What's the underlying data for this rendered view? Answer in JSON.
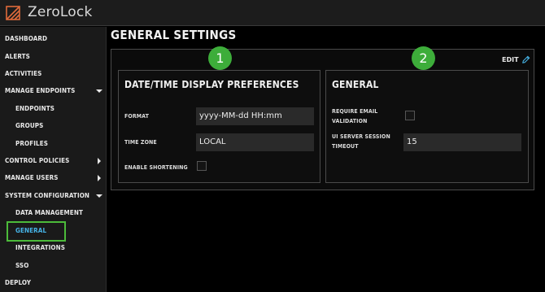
{
  "app": {
    "title": "ZeroLock",
    "logo_icon": "zerolock-logo-icon"
  },
  "colors": {
    "accent_active": "#46b3e6",
    "highlight_green": "#4cbb3a",
    "badge_green": "#3dad3a",
    "logo_orange": "#e06a3b"
  },
  "sidebar": {
    "items": [
      {
        "label": "DASHBOARD"
      },
      {
        "label": "ALERTS"
      },
      {
        "label": "ACTIVITIES"
      },
      {
        "label": "MANAGE ENDPOINTS",
        "icon": "chevron-down-icon"
      },
      {
        "label": "ENDPOINTS"
      },
      {
        "label": "GROUPS"
      },
      {
        "label": "PROFILES"
      },
      {
        "label": "CONTROL POLICIES",
        "icon": "chevron-right-icon"
      },
      {
        "label": "MANAGE USERS",
        "icon": "chevron-right-icon"
      },
      {
        "label": "SYSTEM CONFIGURATION",
        "icon": "chevron-down-icon"
      },
      {
        "label": "DATA MANAGEMENT"
      },
      {
        "label": "GENERAL",
        "active": true
      },
      {
        "label": "INTEGRATIONS"
      },
      {
        "label": "SSO"
      },
      {
        "label": "DEPLOY"
      }
    ]
  },
  "main": {
    "page_title": "GENERAL SETTINGS",
    "edit_label": "EDIT",
    "edit_icon": "pencil-icon",
    "badges": [
      "1",
      "2"
    ],
    "datetime_card": {
      "title": "DATE/TIME DISPLAY PREFERENCES",
      "format_label": "FORMAT",
      "format_value": "yyyy-MM-dd HH:mm",
      "timezone_label": "TIME ZONE",
      "timezone_value": "LOCAL",
      "shortening_label": "ENABLE SHORTENING",
      "shortening_checked": false
    },
    "general_card": {
      "title": "GENERAL",
      "email_label_line1": "REQUIRE EMAIL",
      "email_label_line2": "VALIDATION",
      "email_checked": false,
      "timeout_label_line1": "UI SERVER SESSION",
      "timeout_label_line2": "TIMEOUT",
      "timeout_value": "15"
    }
  }
}
